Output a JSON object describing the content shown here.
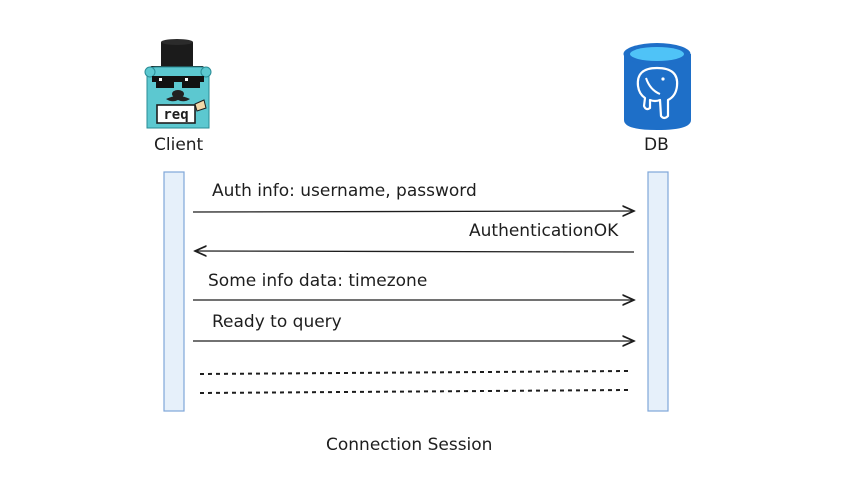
{
  "actors": {
    "client": {
      "label": "Client",
      "logo_text": "req"
    },
    "db": {
      "label": "DB"
    }
  },
  "messages": [
    {
      "label": "Auth info: username, password",
      "direction": "client-to-db"
    },
    {
      "label": "AuthenticationOK",
      "direction": "db-to-client"
    },
    {
      "label": "Some info data: timezone",
      "direction": "client-to-db"
    },
    {
      "label": "Ready to query",
      "direction": "client-to-db"
    }
  ],
  "caption": "Connection Session",
  "colors": {
    "lifeline_fill": "#e6f0fa",
    "lifeline_stroke": "#7fa7d9",
    "db_blue": "#1e6fc8",
    "db_top": "#4fc3f7",
    "gopher": "#5cc8d0",
    "ink": "#1e1e1e"
  }
}
